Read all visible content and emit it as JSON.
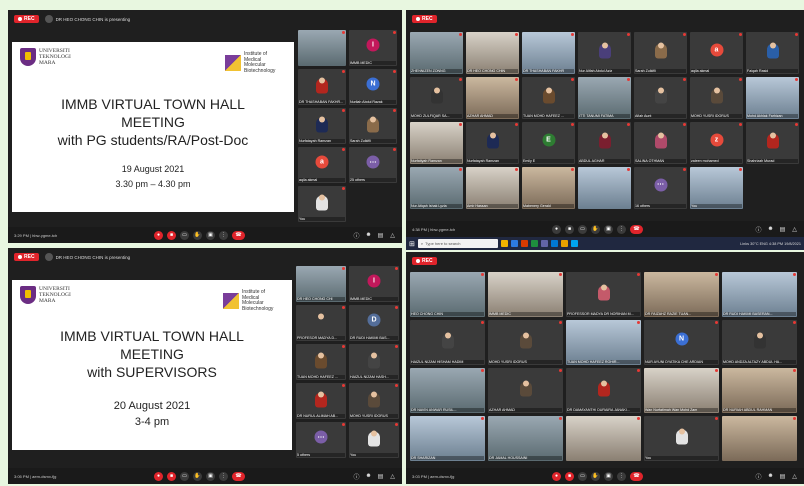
{
  "tl": {
    "rec": "REC",
    "presenting": "DR HEO CHONG CHIN is presenting",
    "slide": {
      "uni": [
        "UNIVERSITI",
        "TEKNOLOGI",
        "MARA"
      ],
      "inst": "Institute of Medical Molecular Biotechnology",
      "inst_short": "Institute of",
      "line1": "IMMB VIRTUAL TOWN HALL",
      "line2": "MEETING",
      "line3": "with PG students/RA/Post-Doc",
      "date": "19 August 2021",
      "time": "3.30 pm – 4.30 pm"
    },
    "tiles": [
      {
        "n": "",
        "k": "cam"
      },
      {
        "n": "IMMB MEDIC",
        "k": "av",
        "c": "#c2185b",
        "l": "I"
      },
      {
        "n": "DR THASHABAN FAKHR...",
        "k": "ph",
        "c": "#b3261e"
      },
      {
        "n": "Nurliah Abdul Razak",
        "k": "av",
        "c": "#3b6fd4",
        "l": "N"
      },
      {
        "n": "Nurfatayah Ramzan",
        "k": "ph",
        "c": "#1d2a55"
      },
      {
        "n": "Sarah Zulkifli",
        "k": "ph",
        "c": "#8a6b4a"
      },
      {
        "n": "aqila akmal",
        "k": "av",
        "c": "#e64a3b",
        "l": "a"
      },
      {
        "n": "25 others",
        "k": "oth"
      },
      {
        "n": "You",
        "k": "ph",
        "c": "#e3e3e3"
      }
    ],
    "bar": "3:29 PM | hbw-ygme-tch"
  },
  "tr": {
    "rec": "REC",
    "tiles": [
      {
        "n": "ZHENNIZEN ZONNG",
        "k": "cam"
      },
      {
        "n": "DR HEO CHONG CHIN",
        "k": "cam2"
      },
      {
        "n": "DR THASHABAN FAKHR",
        "k": "cam3"
      },
      {
        "n": "Nur Alifah Abdul Aziz",
        "k": "ph",
        "c": "#4a3f7a"
      },
      {
        "n": "Sarah Zulkifli",
        "k": "ph",
        "c": "#8a6b4a"
      },
      {
        "n": "aqila akmal",
        "k": "av",
        "c": "#e64a3b",
        "l": "a"
      },
      {
        "n": "Faiqah Rasid",
        "k": "ph",
        "c": "#2a5fa8"
      },
      {
        "n": "MOHD ZULFIQAR SA...",
        "k": "ph",
        "c": "#333"
      },
      {
        "n": "AZHAR AHMAD",
        "k": "cam4"
      },
      {
        "n": "TUAN MOHD HAFEEZ ...",
        "k": "ph",
        "c": "#6a4b2e"
      },
      {
        "n": "ITTI TANUMI FATIMA",
        "k": "cam"
      },
      {
        "n": "Afiah Aunt",
        "k": "ph",
        "c": "#444"
      },
      {
        "n": "MOHD YUSRI IDORUS",
        "k": "ph",
        "c": "#5a4a3a"
      },
      {
        "n": "Mohd Akhlak Farhizan",
        "k": "cam3"
      },
      {
        "n": "Nurfatiyah Ramzan",
        "k": "cam2"
      },
      {
        "n": "Nurfatayah Ramzan",
        "k": "ph",
        "c": "#1d2a55"
      },
      {
        "n": "Emily E",
        "k": "av",
        "c": "#2e7d32",
        "l": "E"
      },
      {
        "n": "ABDUL AGHAR",
        "k": "ph",
        "c": "#7a1f2f"
      },
      {
        "n": "SALINA OTHMAN",
        "k": "ph",
        "c": "#b04a6a"
      },
      {
        "n": "zaleen mohamed",
        "k": "av",
        "c": "#e64a3b",
        "l": "z"
      },
      {
        "n": "Shahrizah Murad",
        "k": "ph",
        "c": "#b3261e"
      },
      {
        "n": "Nur Atiqah Ishak Lyzia",
        "k": "cam"
      },
      {
        "n": "Amir Hassan",
        "k": "cam2"
      },
      {
        "n": "Mabenery Gerald",
        "k": "cam4"
      },
      {
        "n": "",
        "k": "cam3"
      },
      {
        "n": "16 others",
        "k": "oth"
      },
      {
        "n": "You",
        "k": "cam3"
      }
    ],
    "bar": "4:38 PM | hbw-ygme-tch"
  },
  "taskbar": {
    "search": "Type here to search",
    "right": "Links  30°C  ENG  4:38 PM 19/8/2021"
  },
  "bl": {
    "rec": "REC",
    "presenting": "DR HEO CHONG CHIN is presenting",
    "slide": {
      "uni": [
        "UNIVERSITI",
        "TEKNOLOGI",
        "MARA"
      ],
      "inst": "Institute of Medical Molecular Biotechnology",
      "inst_short": "Institute of",
      "line1": "IMMB VIRTUAL TOWN HALL",
      "line2": "MEETING",
      "line3": "with SUPERVISORS",
      "date": "20 August 2021",
      "time": "3-4 pm"
    },
    "tiles": [
      {
        "n": "DR HEO CHONG CHI",
        "k": "cam"
      },
      {
        "n": "IMMB MEDIC",
        "k": "av",
        "c": "#c2185b",
        "l": "I"
      },
      {
        "n": "PROFESOR MADYA D...",
        "k": "ph",
        "c": "#3a3a3a"
      },
      {
        "n": "DR RUDI HAKIMI BAS...",
        "k": "av",
        "c": "#546e9a",
        "l": "D"
      },
      {
        "n": "TUAN MOHD HAFEEZ ...",
        "k": "ph",
        "c": "#6a4b2e"
      },
      {
        "n": "HAIZUL NIZAM HASH...",
        "k": "ph",
        "c": "#444"
      },
      {
        "n": "DR NURUL ALIMAH AB...",
        "k": "ph",
        "c": "#b3261e"
      },
      {
        "n": "MOHD YUSRI IDORUS",
        "k": "ph",
        "c": "#5a4a3a"
      },
      {
        "n": "5 others",
        "k": "oth"
      },
      {
        "n": "You",
        "k": "ph",
        "c": "#e3e3e3"
      }
    ],
    "bar": "3:05 PM | aem-dsmx-fjg"
  },
  "br": {
    "rec": "REC",
    "tiles": [
      {
        "n": "HEO CHONG CHIN",
        "k": "cam"
      },
      {
        "n": "IMMB MEDIC",
        "k": "cam2"
      },
      {
        "n": "PROFESSOR MADYA DR NORIHAN M...",
        "k": "ph",
        "c": "#c45a6a"
      },
      {
        "n": "DR FAIZAHZ RAZIE TUAN...",
        "k": "cam4"
      },
      {
        "n": "DR RUDI HAKIMI BASERAN...",
        "k": "cam3"
      },
      {
        "n": "HAIZUL NIZAM HISHAM HADIM",
        "k": "ph",
        "c": "#444"
      },
      {
        "n": "MOHD YUSRI IDORUS",
        "k": "ph",
        "c": "#5a4a3a"
      },
      {
        "n": "TUAN MOHD HAFEEZ ROHIR...",
        "k": "cam3"
      },
      {
        "n": "NUR AYUNI DYATIKA CHE ARDIAN",
        "k": "av",
        "c": "#3b6fd4",
        "l": "N"
      },
      {
        "n": "MOHD ANDZA ALTAZY ABDUL HA...",
        "k": "ph",
        "c": "#333"
      },
      {
        "n": "DR NAVIN ANWAR RUSIL...",
        "k": "cam"
      },
      {
        "n": "AZHAR AHMAD",
        "k": "ph",
        "c": "#5a4a3a"
      },
      {
        "n": "DR DAMAYANTHI DURAIRA JANAKI...",
        "k": "ph",
        "c": "#b3261e"
      },
      {
        "n": "Wan Nurfatimah Wan Mohd Zam",
        "k": "cam2"
      },
      {
        "n": "DR NURIAH ABDUL RAHMAN",
        "k": "cam4"
      },
      {
        "n": "DR SHARIZAN",
        "k": "cam3"
      },
      {
        "n": "DR JAMAL HOUSSAINI",
        "k": "cam"
      },
      {
        "n": "",
        "k": "cam2"
      },
      {
        "n": "You",
        "k": "ph",
        "c": "#e3e3e3"
      },
      {
        "n": "",
        "k": "cam4"
      }
    ],
    "bar": "3:03 PM | aem-dsmx-fjg"
  }
}
